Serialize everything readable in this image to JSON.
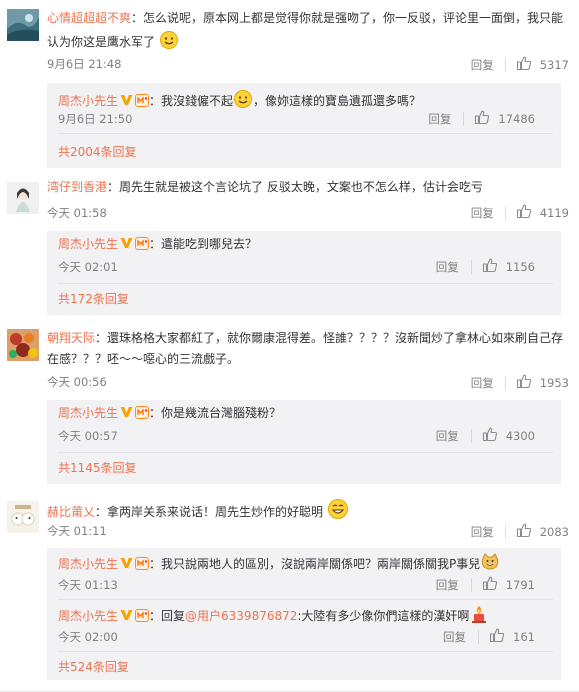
{
  "threads": [
    {
      "user": "心情超超超不爽",
      "text_a": "：怎么说呢，原本网上都是觉得你就是强吻了，你一反驳，评论里一面倒，我只能",
      "text_b": "认为你这是鹰水军了",
      "time": "9月6日 21:48",
      "reply_label": "回复",
      "likes": "5317",
      "replies": [
        {
          "user": "周杰小先生",
          "text_a": "：我沒錢僱不起",
          "text_b": "，像妳這樣的寶島遺孤還多嗎？",
          "time": "9月6日 21:50",
          "reply_label": "回复",
          "likes": "17486"
        }
      ],
      "more": "共2004条回复"
    },
    {
      "user": "湾仔到香港",
      "text_a": "：周先生就是被这个言论坑了 反驳太晚，文案也不怎么样，估计会吃亏",
      "time": "今天 01:58",
      "reply_label": "回复",
      "likes": "4119",
      "replies": [
        {
          "user": "周杰小先生",
          "text_a": "：遣能吃到哪兒去？",
          "time": "今天 02:01",
          "reply_label": "回复",
          "likes": "1156"
        }
      ],
      "more": "共172条回复"
    },
    {
      "user": "朝翔天际",
      "text_a": "：還珠格格大家都紅了，就你爾康混得差。怪誰？？？？沒新聞炒了拿林心如來刷自己存",
      "text_b": "在感？？？呸～～噁心的三流戲子。",
      "time": "今天 00:56",
      "reply_label": "回复",
      "likes": "1953",
      "replies": [
        {
          "user": "周杰小先生",
          "text_a": "：你是幾流台灣腦殘粉？",
          "time": "今天 00:57",
          "reply_label": "回复",
          "likes": "4300"
        }
      ],
      "more": "共1145条回复"
    },
    {
      "user": "赫比莆乂",
      "text_a": "：拿两岸关系来说话！周先生炒作的好聪明",
      "time": "今天 01:11",
      "reply_label": "回复",
      "likes": "2083",
      "replies": [
        {
          "user": "周杰小先生",
          "text_a": "：我只說兩地人的區別，沒說兩岸關係吧？兩岸關係關我P事兒",
          "time": "今天 01:13",
          "reply_label": "回复",
          "likes": "1791"
        },
        {
          "user": "周杰小先生",
          "text_a": "：回复",
          "mention": "@用户6339876872",
          "text_b": ":大陸有多少像你們這樣的漢奸啊",
          "time": "今天 02:00",
          "reply_label": "回复",
          "likes": "161"
        }
      ],
      "more": "共524条回复"
    }
  ]
}
